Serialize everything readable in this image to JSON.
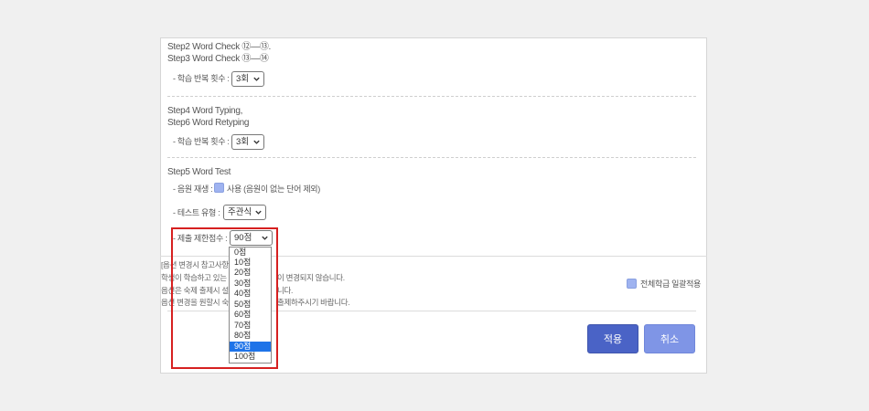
{
  "step2_label": "Step2 Word Check ⑫—⑬.",
  "step3_label": "Step3 Word Check ⑬—⑭",
  "repeat_label": "- 학습 반복 횟수 :",
  "repeat_value_1": "3회",
  "step4_label": "Step4 Word Typing,",
  "step6_label": "Step6 Word Retyping",
  "repeat_label_2": "- 학습 반복 횟수 :",
  "repeat_value_2": "3회",
  "step5_label": "Step5 Word Test",
  "voice_label": "- 음원 재생 :",
  "voice_option": "사용 (음원이 없는 단어 제외)",
  "test_type_label": "- 테스트 유형 :",
  "test_type_value": "주관식",
  "limit_score_label": "- 제출 제한점수 :",
  "limit_score_value": "90점",
  "notes": [
    "[옵션 변경시 참고사항",
    "학생이 학습하고 있는",
    "옵션은 숙제 출제시 설",
    "옵션 변경을 원할시 숙"
  ],
  "notes_tail": [
    "이 변경되지 않습니다.",
    "니다.",
    "출제하주시기 바랍니다."
  ],
  "apply_all_label": "전체학급 일괄적용",
  "apply_button": "적용",
  "cancel_button": "취소",
  "score_options": [
    "0점",
    "10점",
    "20점",
    "30점",
    "40점",
    "50점",
    "60점",
    "70점",
    "80점",
    "90점",
    "100점"
  ],
  "selected_option_index": 9,
  "colors": {
    "accent": "#4a63c6",
    "cancel": "#7f95e6",
    "highlight_box": "#d62020",
    "selected_option": "#1e73e8"
  },
  "icons": {
    "select_arrow": "chevron-down-icon",
    "checkbox": "checkbox-checked-icon"
  }
}
